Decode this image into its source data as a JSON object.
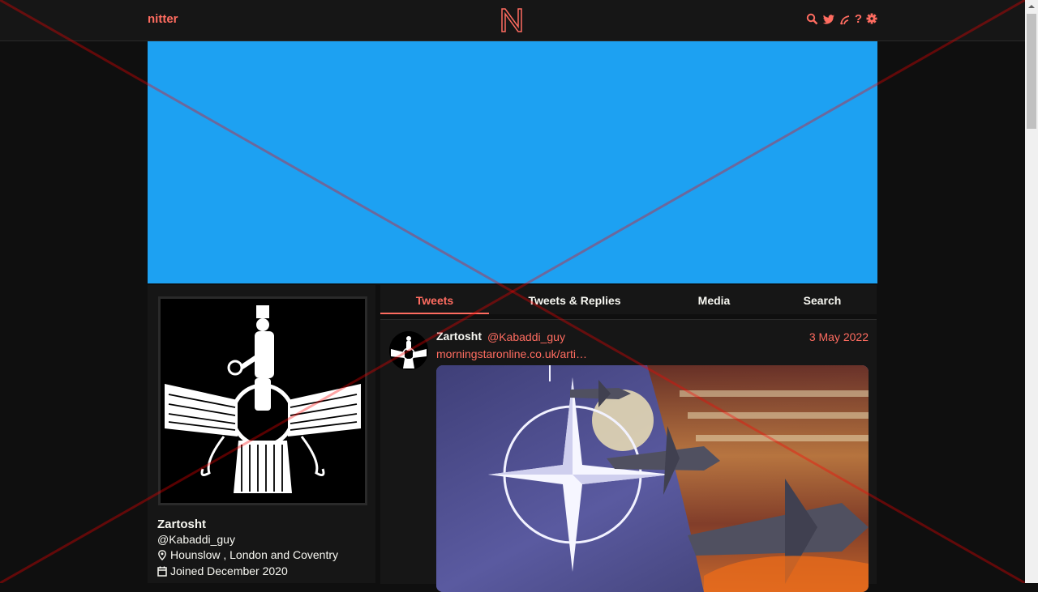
{
  "nav": {
    "brand": "nitter",
    "icons": [
      "search-icon",
      "bird-icon",
      "rss-icon",
      "help-icon",
      "gear-icon"
    ],
    "help_glyph": "?",
    "accent": "#ff6c60"
  },
  "banner": {
    "color": "#1da1f2"
  },
  "profile": {
    "fullname": "Zartosht",
    "username": "@Kabaddi_guy",
    "location": "Hounslow , London and Coventry",
    "joined": "Joined December 2020"
  },
  "tabs": [
    {
      "label": "Tweets",
      "active": true
    },
    {
      "label": "Tweets & Replies",
      "active": false
    },
    {
      "label": "Media",
      "active": false
    },
    {
      "label": "Search",
      "active": false
    }
  ],
  "tweet": {
    "fullname": "Zartosht",
    "username": "@Kabaddi_guy",
    "date": "3 May 2022",
    "link_text": "morningstaronline.co.uk/arti…"
  }
}
